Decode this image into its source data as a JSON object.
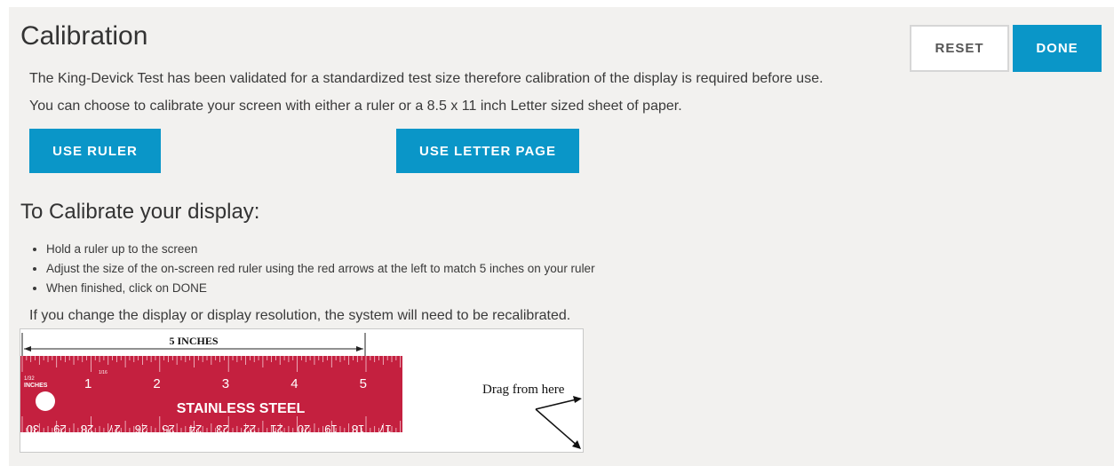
{
  "header": {
    "title": "Calibration",
    "reset_label": "RESET",
    "done_label": "DONE"
  },
  "intro": {
    "line1": "The King-Devick Test has been validated for a standardized test size therefore calibration of the display is required before use.",
    "line2": "You can choose to calibrate your screen with either a ruler or a 8.5 x 11 inch Letter sized sheet of paper."
  },
  "options": {
    "use_ruler_label": "USE RULER",
    "use_letter_label": "USE LETTER PAGE"
  },
  "instructions": {
    "heading": "To Calibrate your display:",
    "items": [
      "Hold a ruler up to the screen",
      "Adjust the size of the on-screen red ruler using the red arrows at the left to match 5 inches on your ruler",
      "When finished, click on DONE"
    ],
    "note": "If you change the display or display resolution, the system will need to be recalibrated."
  },
  "ruler": {
    "dimension_label": "5 INCHES",
    "brand_text": "STAINLESS STEEL",
    "units_text": "INCHES",
    "small_marks": [
      "1/32",
      "1/16"
    ],
    "top_numbers": [
      "1",
      "2",
      "3",
      "4",
      "5"
    ],
    "bottom_numbers": [
      "30",
      "29",
      "28",
      "27",
      "26",
      "25",
      "24",
      "23",
      "22",
      "21",
      "20",
      "19",
      "18",
      "17"
    ],
    "drag_hint": "Drag from here",
    "color": "#c4203f"
  }
}
